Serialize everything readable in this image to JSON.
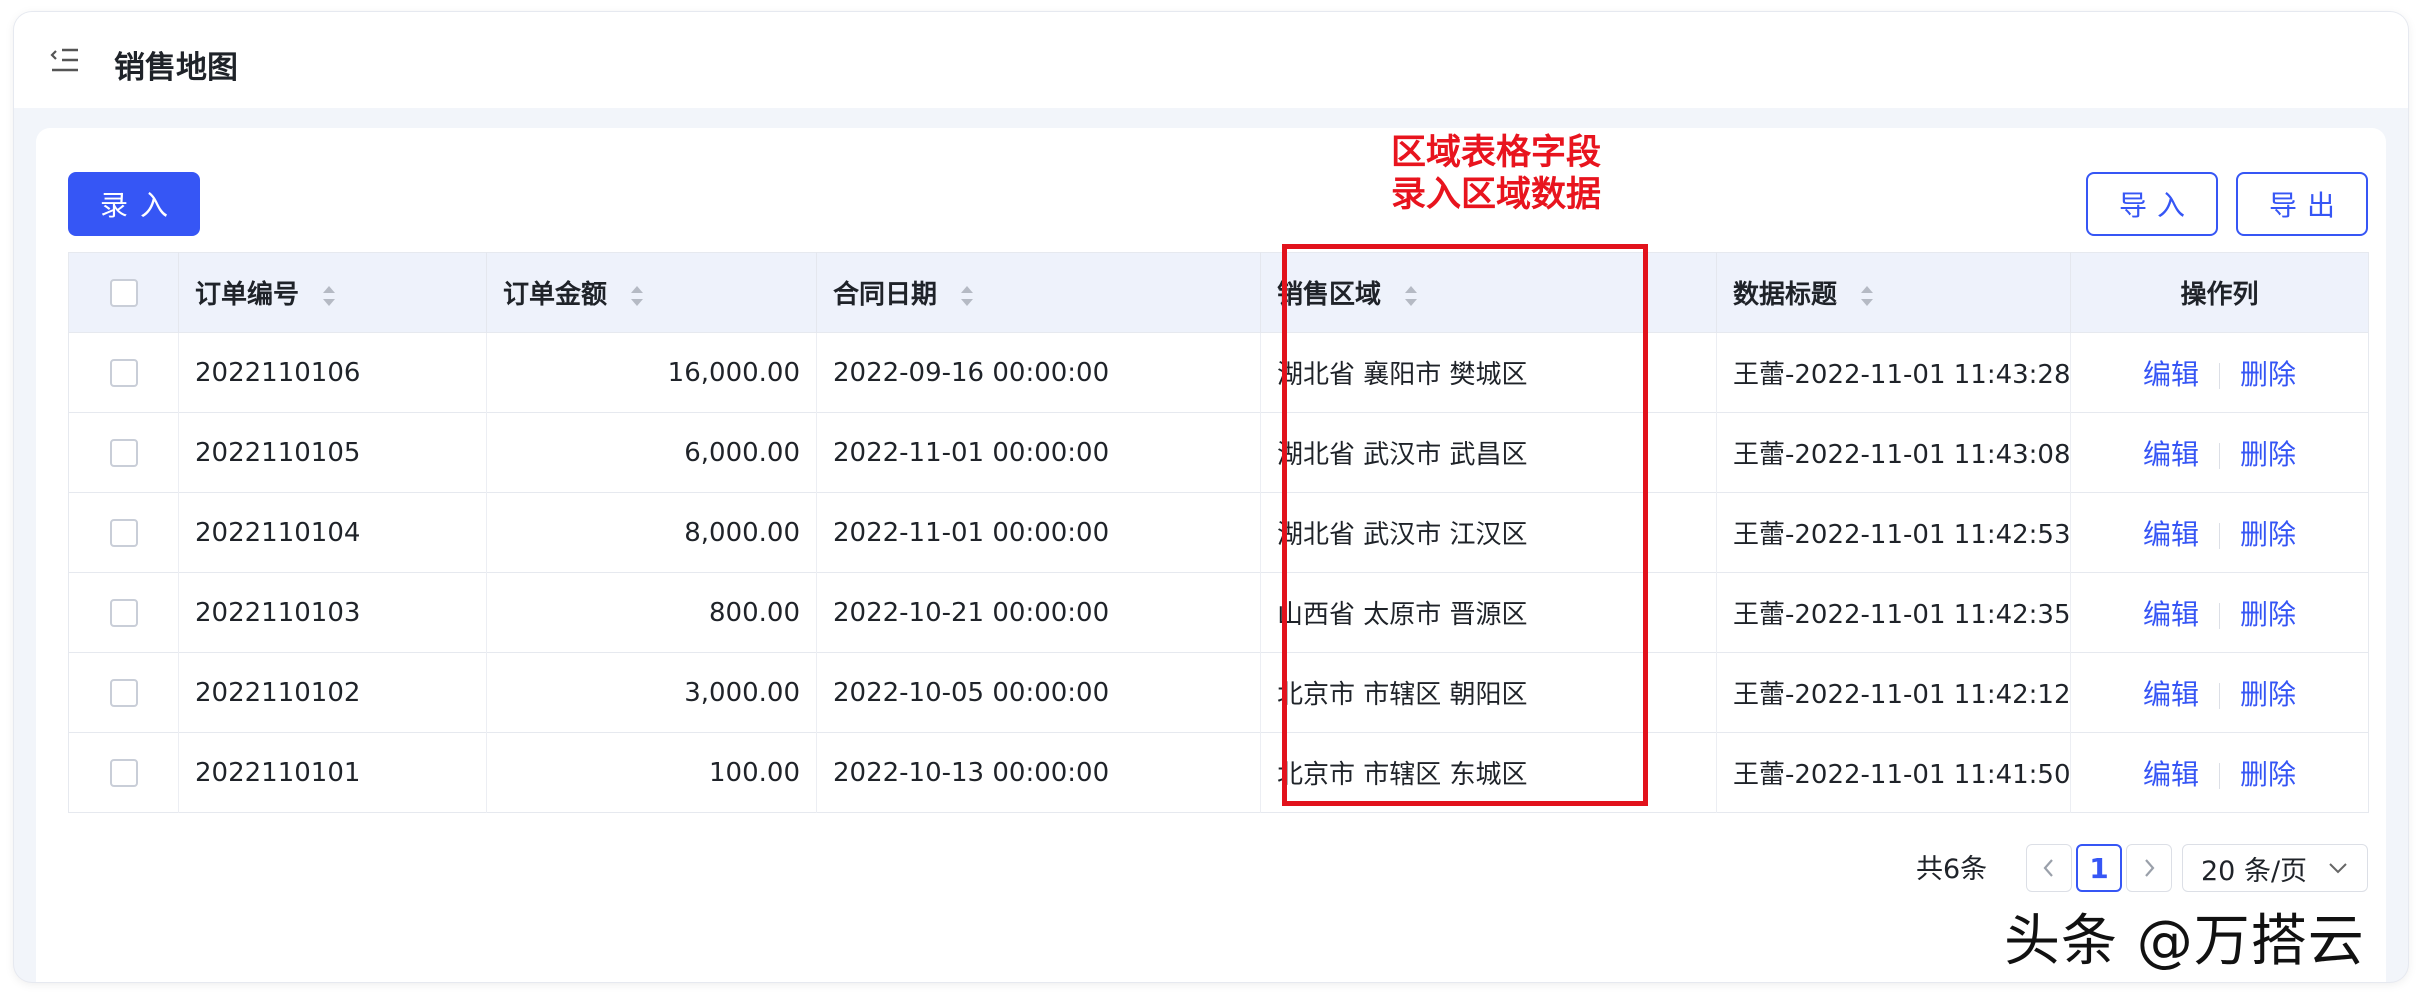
{
  "header": {
    "title": "销售地图"
  },
  "toolbar": {
    "create_label": "录入",
    "import_label": "导入",
    "export_label": "导出"
  },
  "annotation": {
    "line1": "区域表格字段",
    "line2": "录入区域数据"
  },
  "table": {
    "columns": [
      "订单编号",
      "订单金额",
      "合同日期",
      "销售区域",
      "数据标题",
      "操作列"
    ],
    "rows": [
      {
        "order_no": "2022110106",
        "amount": "16,000.00",
        "date": "2022-09-16 00:00:00",
        "region": "湖北省 襄阳市 樊城区",
        "title": "王蕾-2022-11-01 11:43:28"
      },
      {
        "order_no": "2022110105",
        "amount": "6,000.00",
        "date": "2022-11-01 00:00:00",
        "region": "湖北省 武汉市 武昌区",
        "title": "王蕾-2022-11-01 11:43:08"
      },
      {
        "order_no": "2022110104",
        "amount": "8,000.00",
        "date": "2022-11-01 00:00:00",
        "region": "湖北省 武汉市 江汉区",
        "title": "王蕾-2022-11-01 11:42:53"
      },
      {
        "order_no": "2022110103",
        "amount": "800.00",
        "date": "2022-10-21 00:00:00",
        "region": "山西省 太原市 晋源区",
        "title": "王蕾-2022-11-01 11:42:35"
      },
      {
        "order_no": "2022110102",
        "amount": "3,000.00",
        "date": "2022-10-05 00:00:00",
        "region": "北京市 市辖区 朝阳区",
        "title": "王蕾-2022-11-01 11:42:12"
      },
      {
        "order_no": "2022110101",
        "amount": "100.00",
        "date": "2022-10-13 00:00:00",
        "region": "北京市 市辖区 东城区",
        "title": "王蕾-2022-11-01 11:41:50"
      }
    ],
    "ops": {
      "edit": "编辑",
      "delete": "删除"
    }
  },
  "pagination": {
    "total": "共6条",
    "current_page": "1",
    "page_size": "20 条/页"
  },
  "watermark": "头条 @万搭云",
  "icons": {
    "menu": "menu-fold-icon",
    "sort": "sort-icon",
    "prev": "chevron-left-icon",
    "next": "chevron-right-icon",
    "dropdown": "chevron-down-icon"
  },
  "colors": {
    "primary": "#3656f5",
    "annotation": "#e2121c",
    "header_bg": "#eef2fb",
    "page_bg": "#f2f5fa"
  }
}
